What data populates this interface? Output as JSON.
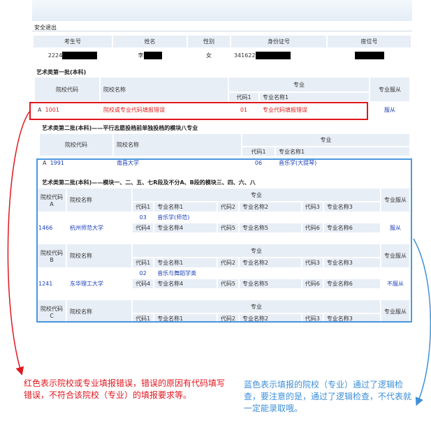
{
  "app": {
    "logout": "安全退出"
  },
  "colors": {
    "error": "#e0161e",
    "ok": "#4a98e0",
    "link": "#1a3eb8",
    "header_bg": "#e8eef6"
  },
  "student": {
    "headers": [
      "考生号",
      "姓名",
      "性别",
      "身份证号",
      "座位号"
    ],
    "values": {
      "id": "2224",
      "name": "李",
      "gender": "女",
      "idcard": "341622"
    }
  },
  "s1": {
    "title": "艺术类第一批(本科)",
    "h_code": "院校代码",
    "h_name": "院校名称",
    "h_major": "专业",
    "h_mc": "代码1",
    "h_mn": "专业名称1",
    "h_obey": "专业服从",
    "row": {
      "idx": "A",
      "code": "1001",
      "school": "院校或专业代码填报错误",
      "mcode": "01",
      "mname": "专业代码填报错误",
      "obey": "服从"
    }
  },
  "s2": {
    "title": "艺术类第二批(本科)——平行志愿投档前单独投档的模块八专业",
    "h_code": "院校代码",
    "h_name": "院校名称",
    "h_major": "专业",
    "h_mc": "代码1",
    "h_mn": "专业名称1",
    "row": {
      "idx": "A",
      "code": "1991",
      "school": "南昌大学",
      "mcode": "06",
      "mname": "音乐学(大提琴)"
    }
  },
  "s3": {
    "title": "艺术类第二批(本科)——模块一、二、五、七R段及不分A、B段的模块三、四、六、八",
    "h_major": "专业",
    "h_obey": "专业服从",
    "h_code": "院校代码",
    "h_name": "院校名称",
    "c1": "代码1",
    "n1": "专业名称1",
    "c2": "代码2",
    "n2": "专业名称2",
    "c3": "代码3",
    "n3": "专业名称3",
    "c4": "代码4",
    "n4": "专业名称4",
    "c5": "代码5",
    "n5": "专业名称5",
    "c6": "代码6",
    "n6": "专业名称6",
    "g1": {
      "letter": "A",
      "code": "1466",
      "school": "杭州师范大学",
      "mcode": "03",
      "mname": "音乐学(师范)",
      "obey": "服从"
    },
    "g2": {
      "letter": "B",
      "code": "1241",
      "school": "东华理工大学",
      "mcode": "02",
      "mname": "音乐与舞蹈学类",
      "obey": "不服从"
    },
    "g3": {
      "letter": "C"
    }
  },
  "notes": {
    "red": "红色表示院校或专业填报错误，错误的原因有代码填写错误，不符合该院校（专业）的填报要求等。",
    "blue": "蓝色表示填报的院校（专业）通过了逻辑检查，要注意的是，通过了逻辑检查，不代表就一定能录取哦。"
  }
}
